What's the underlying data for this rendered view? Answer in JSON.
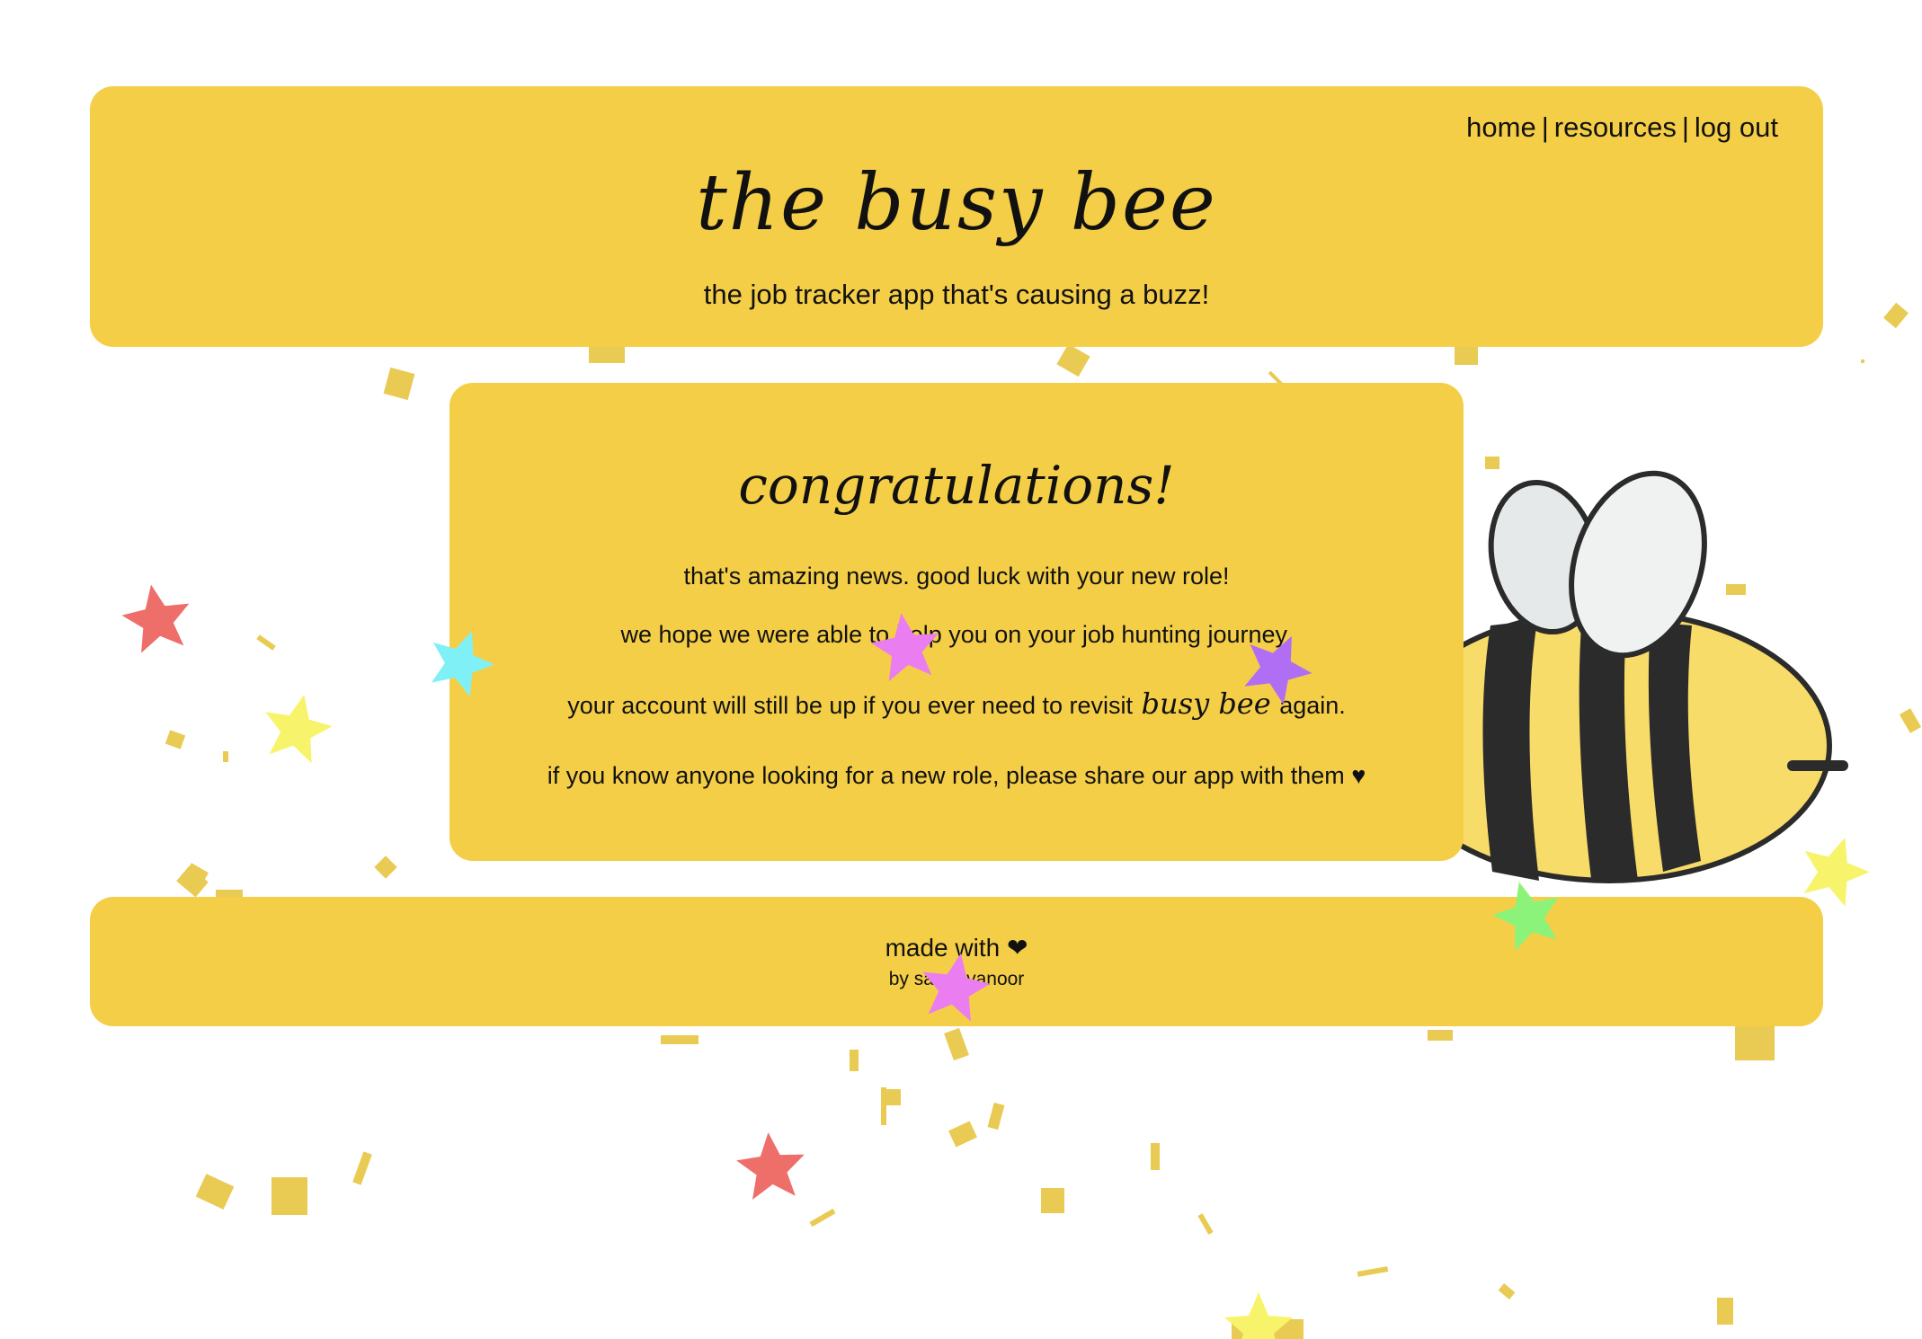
{
  "nav": {
    "home": "home",
    "resources": "resources",
    "logout": "log out",
    "separator": "|"
  },
  "header": {
    "title": "the busy bee",
    "tagline": "the job tracker app that's causing a buzz!"
  },
  "card": {
    "heading": "congratulations!",
    "line1": "that's amazing news. good luck with your new role!",
    "line2": "we hope we were able to help you on your job hunting journey.",
    "line3_before": "your account will still be up if you ever need to revisit",
    "line3_brand": "busy bee",
    "line3_after": "again.",
    "line4": "if you know anyone looking for a new role, please share our app with them ♥"
  },
  "footer": {
    "made_with": "made with ❤",
    "by": "by sarah vanoor"
  },
  "colors": {
    "panel": "#f5ce47",
    "confetti": "#e8c84a",
    "bee_yellow": "#f7dc6a",
    "bee_stripe": "#2b2b2b",
    "wing": "#eef0f0"
  },
  "icons": {
    "bee": "bee-illustration",
    "stars": "star-confetti",
    "confetti": "gold-confetti"
  }
}
